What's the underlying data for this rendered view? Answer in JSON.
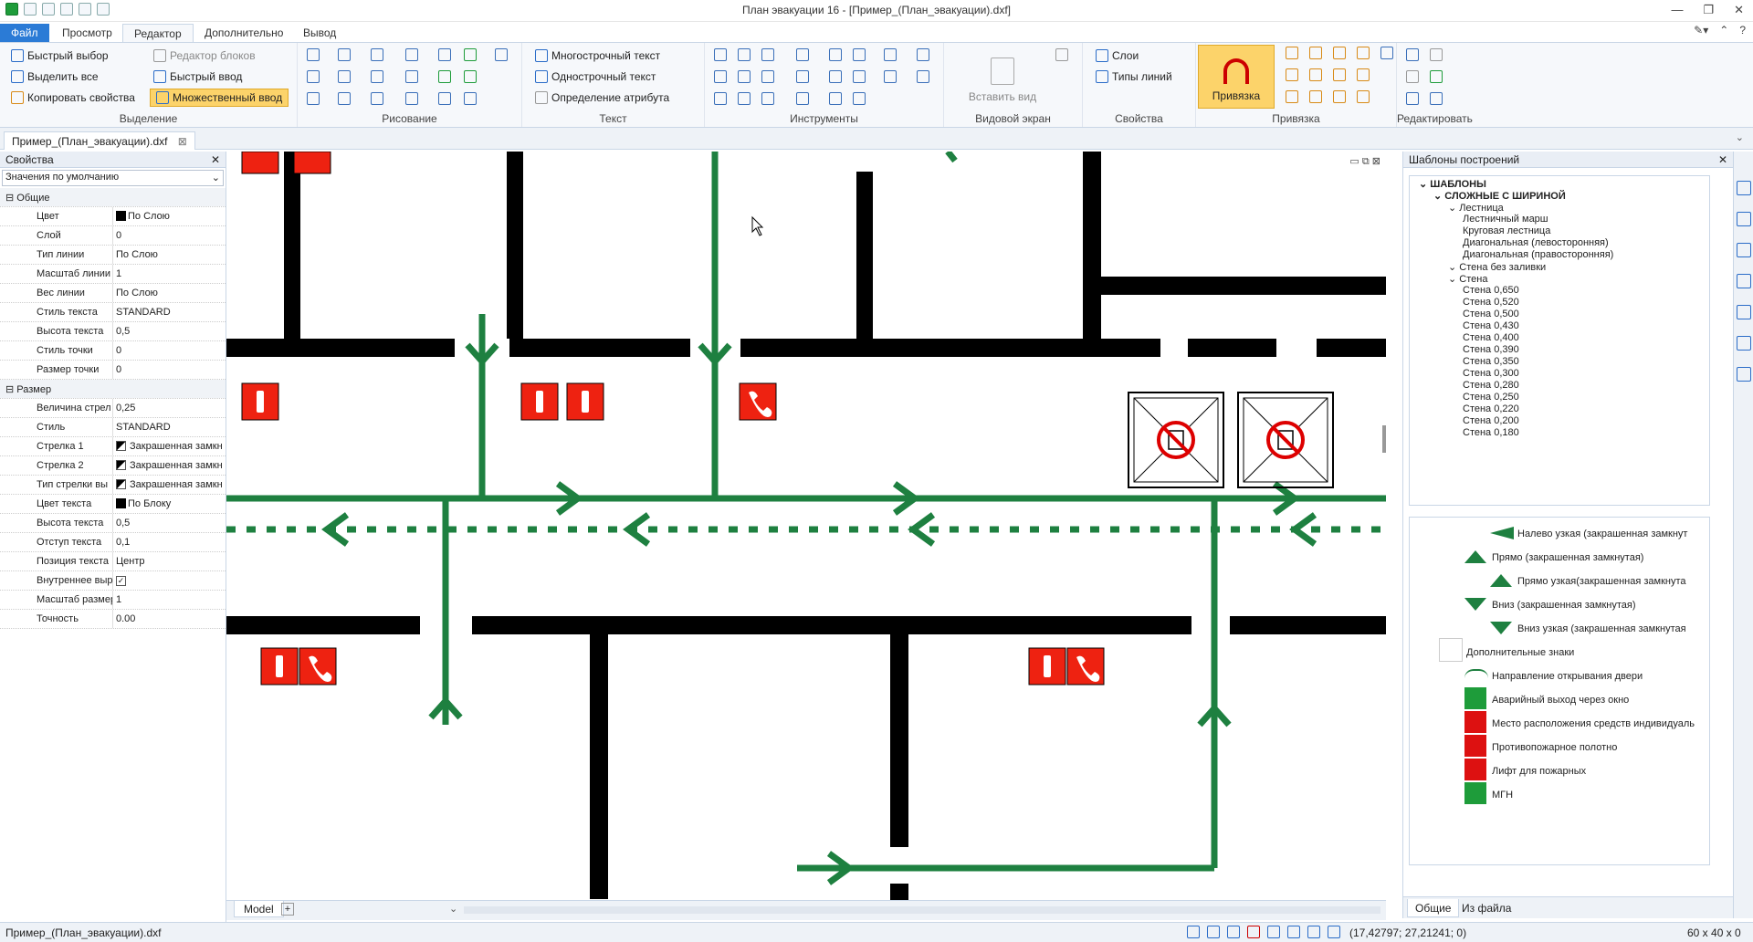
{
  "window": {
    "title": "План эвакуации 16 - [Пример_(План_эвакуации).dxf]"
  },
  "menu_tabs": [
    "Файл",
    "Просмотр",
    "Редактор",
    "Дополнительно",
    "Вывод"
  ],
  "ribbon": {
    "selection": {
      "quick_select": "Быстрый выбор",
      "select_all": "Выделить все",
      "copy_props": "Копировать свойства",
      "block_editor": "Редактор блоков",
      "quick_input": "Быстрый ввод",
      "multi_input": "Множественный ввод",
      "label": "Выделение"
    },
    "drawing": {
      "label": "Рисование"
    },
    "text": {
      "mtext": "Многострочный текст",
      "stext": "Однострочный текст",
      "attdef": "Определение атрибута",
      "label": "Текст"
    },
    "tools": {
      "label": "Инструменты"
    },
    "viewport": {
      "insert_view": "Вставить вид",
      "label": "Видовой экран"
    },
    "properties": {
      "layers": "Слои",
      "linetypes": "Типы линий",
      "label": "Свойства"
    },
    "snap": {
      "snap_btn": "Привязка",
      "label": "Привязка"
    },
    "editing": {
      "label": "Редактировать"
    }
  },
  "doc_tab": "Пример_(План_эвакуации).dxf",
  "properties_panel": {
    "title": "Свойства",
    "combo": "Значения по умолчанию",
    "rows": [
      {
        "type": "section",
        "name": "Общие"
      },
      {
        "name": "Цвет",
        "value": "По Слою",
        "swatch": "#000000"
      },
      {
        "name": "Слой",
        "value": "0"
      },
      {
        "name": "Тип линии",
        "value": "По Слою"
      },
      {
        "name": "Масштаб линии",
        "value": "1"
      },
      {
        "name": "Вес линии",
        "value": "По Слою"
      },
      {
        "name": "Стиль текста",
        "value": "STANDARD"
      },
      {
        "name": "Высота текста",
        "value": "0,5"
      },
      {
        "name": "Стиль точки",
        "value": "0"
      },
      {
        "name": "Размер точки",
        "value": "0"
      },
      {
        "type": "section",
        "name": "Размер"
      },
      {
        "name": "Величина стрел",
        "value": "0,25"
      },
      {
        "name": "Стиль",
        "value": "STANDARD"
      },
      {
        "name": "Стрелка 1",
        "value": "Закрашенная замкн",
        "arrow": true
      },
      {
        "name": "Стрелка 2",
        "value": "Закрашенная замкн",
        "arrow": true
      },
      {
        "name": "Тип стрелки вы",
        "value": "Закрашенная замкн",
        "arrow": true
      },
      {
        "name": "Цвет текста",
        "value": "По Блоку",
        "swatch": "#000000"
      },
      {
        "name": "Высота текста",
        "value": "0,5"
      },
      {
        "name": "Отступ текста",
        "value": "0,1"
      },
      {
        "name": "Позиция текста",
        "value": "Центр"
      },
      {
        "name": "Внутреннее выр",
        "value": "✓",
        "check": true
      },
      {
        "name": "Масштаб размер",
        "value": "1"
      },
      {
        "name": "Точность",
        "value": "0.00"
      }
    ]
  },
  "templates_panel": {
    "title": "Шаблоны построений",
    "tree": [
      {
        "text": "ШАБЛОНЫ",
        "level": 0,
        "bold": true
      },
      {
        "text": "СЛОЖНЫЕ С ШИРИНОЙ",
        "level": 1,
        "bold": true
      },
      {
        "text": "Лестница",
        "level": 2
      },
      {
        "text": "Лестничный марш",
        "level": 3
      },
      {
        "text": "Круговая лестница",
        "level": 3
      },
      {
        "text": "Диагональная (левосторонняя)",
        "level": 3
      },
      {
        "text": "Диагональная (правосторонняя)",
        "level": 3
      },
      {
        "text": "Стена без заливки",
        "level": 2
      },
      {
        "text": "Стена",
        "level": 2
      },
      {
        "text": "Стена 0,650",
        "level": 3
      },
      {
        "text": "Стена 0,520",
        "level": 3
      },
      {
        "text": "Стена 0,500",
        "level": 3
      },
      {
        "text": "Стена 0,430",
        "level": 3
      },
      {
        "text": "Стена 0,400",
        "level": 3
      },
      {
        "text": "Стена 0,390",
        "level": 3
      },
      {
        "text": "Стена 0,350",
        "level": 3
      },
      {
        "text": "Стена 0,300",
        "level": 3
      },
      {
        "text": "Стена 0,280",
        "level": 3
      },
      {
        "text": "Стена 0,250",
        "level": 3
      },
      {
        "text": "Стена 0,220",
        "level": 3
      },
      {
        "text": "Стена 0,200",
        "level": 3
      },
      {
        "text": "Стена 0,180",
        "level": 3
      }
    ],
    "gallery": [
      {
        "text": "Налево узкая (закрашенная замкнут",
        "icon": "arrow-left-icon"
      },
      {
        "text": "Прямо (закрашенная замкнутая)",
        "icon": "arrow-up-icon"
      },
      {
        "text": "Прямо узкая(закрашенная замкнута",
        "icon": "arrow-up-narrow-icon"
      },
      {
        "text": "Вниз (закрашенная замкнутая)",
        "icon": "arrow-down-icon"
      },
      {
        "text": "Вниз узкая (закрашенная замкнутая",
        "icon": "arrow-down-narrow-icon"
      },
      {
        "text": "Дополнительные знаки",
        "icon": "folder-icon"
      },
      {
        "text": "Направление открывания двери",
        "icon": "door-arc-icon"
      },
      {
        "text": "Аварийный выход через окно",
        "icon": "window-exit-icon"
      },
      {
        "text": "Место расположения средств индивидуаль",
        "icon": "ppe-icon"
      },
      {
        "text": "Противопожарное полотно",
        "icon": "fire-blanket-icon"
      },
      {
        "text": "Лифт для пожарных",
        "icon": "fire-lift-icon"
      },
      {
        "text": "МГН",
        "icon": "wheelchair-icon"
      }
    ],
    "tabs": [
      "Общие",
      "Из файла"
    ]
  },
  "model_tab": "Model",
  "status": {
    "file": "Пример_(План_эвакуации).dxf",
    "coords": "(17,42797; 27,21241; 0)",
    "grid": "60 x 40 x 0"
  }
}
